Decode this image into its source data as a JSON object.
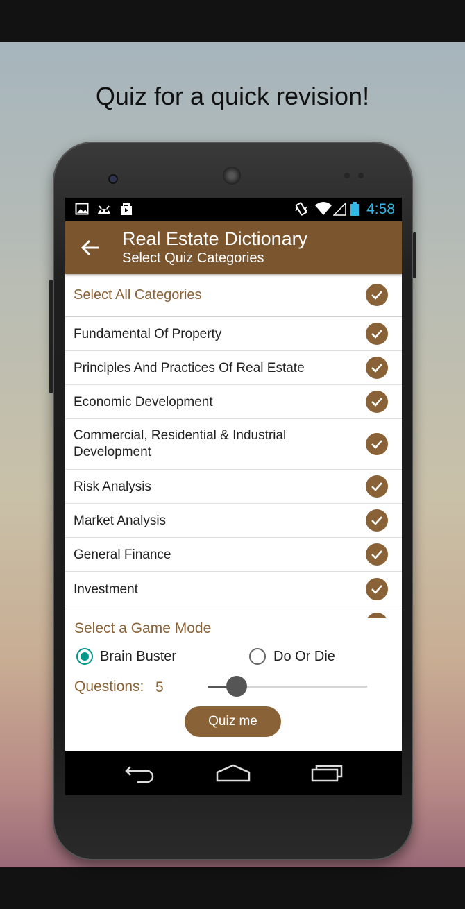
{
  "promo": {
    "caption": "Quiz for a quick revision!"
  },
  "status_bar": {
    "left_icons": [
      "image-notification-icon",
      "android-notification-icon",
      "store-notification-icon"
    ],
    "right_icons": [
      "vibrate-icon",
      "wifi-icon",
      "signal-icon",
      "battery-icon"
    ],
    "time": "4:58"
  },
  "app_bar": {
    "title": "Real Estate Dictionary",
    "subtitle": "Select Quiz Categories",
    "back_icon": "arrow-back-icon"
  },
  "categories": {
    "select_all_label": "Select All Categories",
    "items": [
      {
        "label": "Fundamental Of Property",
        "checked": true
      },
      {
        "label": "Principles And Practices Of Real Estate",
        "checked": true
      },
      {
        "label": "Economic Development",
        "checked": true
      },
      {
        "label": "Commercial, Residential & Industrial Development",
        "checked": true
      },
      {
        "label": "Risk Analysis",
        "checked": true
      },
      {
        "label": "Market Analysis",
        "checked": true
      },
      {
        "label": "General Finance",
        "checked": true
      },
      {
        "label": "Investment",
        "checked": true
      }
    ]
  },
  "game_mode": {
    "title": "Select a Game Mode",
    "options": [
      {
        "label": "Brain Buster",
        "selected": true
      },
      {
        "label": "Do Or Die",
        "selected": false
      }
    ]
  },
  "questions": {
    "label": "Questions:",
    "value": "5",
    "slider_fraction": 0.18
  },
  "quiz_button": {
    "label": "Quiz me"
  },
  "colors": {
    "accent": "#7a552e",
    "check": "#8a6237",
    "radio": "#009688",
    "clock": "#33b5e5"
  },
  "nav_bar": {
    "icons": [
      "back-nav-icon",
      "home-nav-icon",
      "recents-nav-icon"
    ]
  }
}
